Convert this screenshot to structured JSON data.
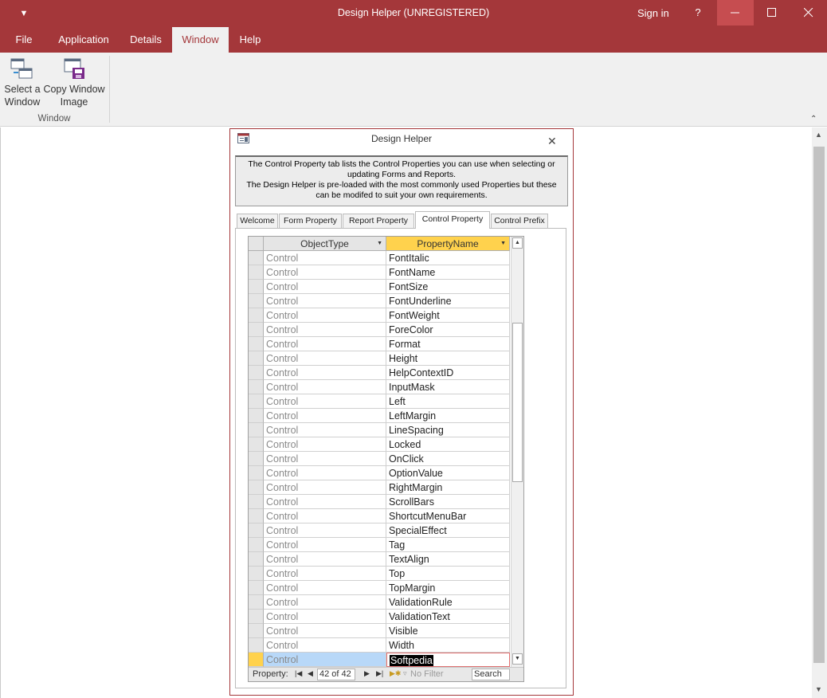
{
  "window": {
    "title": "Design Helper (UNREGISTERED)",
    "sign_in": "Sign in",
    "help": "?",
    "qat_icon": "quick-access-dropdown-icon",
    "accent_color": "#a4373a"
  },
  "ribbon": {
    "tabs": [
      {
        "label": "File"
      },
      {
        "label": "Application"
      },
      {
        "label": "Details"
      },
      {
        "label": "Window",
        "active": true
      },
      {
        "label": "Help"
      }
    ],
    "group_label": "Window",
    "buttons": [
      {
        "label_line1": "Select a",
        "label_line2": "Window",
        "icon": "select-window-icon"
      },
      {
        "label_line1": "Copy Window",
        "label_line2": "Image",
        "icon": "copy-window-image-icon"
      }
    ]
  },
  "form": {
    "title": "Design Helper",
    "info": {
      "line1": "The Control Property tab lists the Control Properties you can use when selecting or updating Forms and Reports.",
      "line2": "The Design Helper is pre-loaded with the most commonly used Properties but these can be modifed to suit your own requirements."
    },
    "tabs": [
      {
        "label": "Welcome"
      },
      {
        "label": "Form Property"
      },
      {
        "label": "Report Property"
      },
      {
        "label": "Control Property",
        "active": true
      },
      {
        "label": "Control Prefix"
      }
    ],
    "datasheet": {
      "columns": [
        "ObjectType",
        "PropertyName"
      ],
      "rows": [
        [
          "Control",
          "FontItalic"
        ],
        [
          "Control",
          "FontName"
        ],
        [
          "Control",
          "FontSize"
        ],
        [
          "Control",
          "FontUnderline"
        ],
        [
          "Control",
          "FontWeight"
        ],
        [
          "Control",
          "ForeColor"
        ],
        [
          "Control",
          "Format"
        ],
        [
          "Control",
          "Height"
        ],
        [
          "Control",
          "HelpContextID"
        ],
        [
          "Control",
          "InputMask"
        ],
        [
          "Control",
          "Left"
        ],
        [
          "Control",
          "LeftMargin"
        ],
        [
          "Control",
          "LineSpacing"
        ],
        [
          "Control",
          "Locked"
        ],
        [
          "Control",
          "OnClick"
        ],
        [
          "Control",
          "OptionValue"
        ],
        [
          "Control",
          "RightMargin"
        ],
        [
          "Control",
          "ScrollBars"
        ],
        [
          "Control",
          "ShortcutMenuBar"
        ],
        [
          "Control",
          "SpecialEffect"
        ],
        [
          "Control",
          "Tag"
        ],
        [
          "Control",
          "TextAlign"
        ],
        [
          "Control",
          "Top"
        ],
        [
          "Control",
          "TopMargin"
        ],
        [
          "Control",
          "ValidationRule"
        ],
        [
          "Control",
          "ValidationText"
        ],
        [
          "Control",
          "Visible"
        ],
        [
          "Control",
          "Width"
        ]
      ],
      "current_row": [
        "Control",
        "Softpedia"
      ],
      "nav": {
        "label": "Property:",
        "position": "42 of 42",
        "filter": "No Filter",
        "search_placeholder": "Search"
      }
    }
  }
}
